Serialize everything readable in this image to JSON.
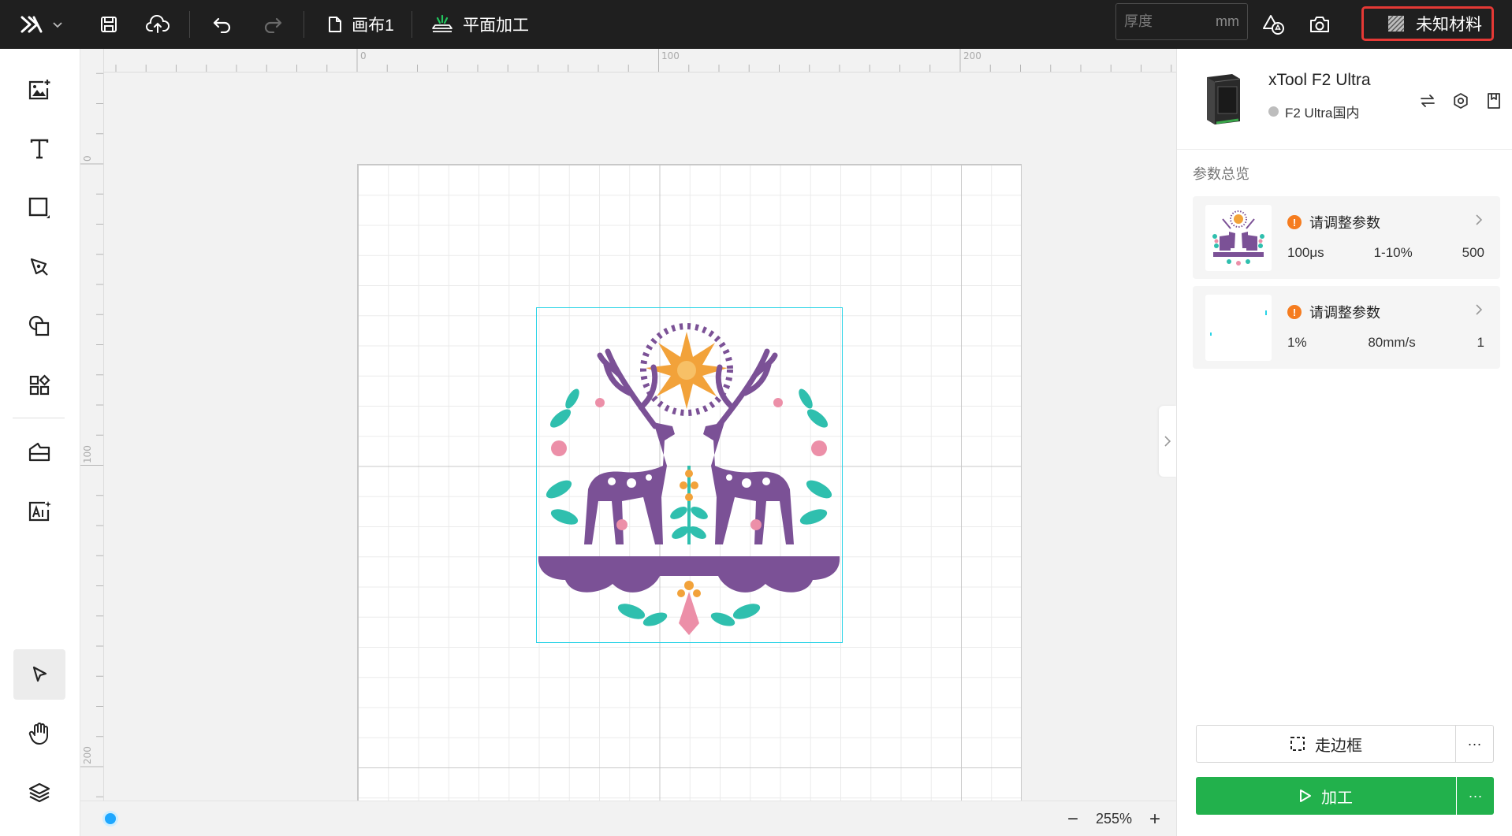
{
  "topbar": {
    "logo_icon": "xtool-x-logo",
    "canvas_name": "画布1",
    "mode_label": "平面加工",
    "thickness": {
      "placeholder": "厚度",
      "value": "",
      "unit": "mm"
    },
    "material_label": "未知材料"
  },
  "leftbar": {
    "tools": [
      "image-add-icon",
      "text-icon",
      "rectangle-icon",
      "pen-icon",
      "shapes-icon",
      "components-icon",
      "material-library-icon",
      "ai-image-icon",
      "select-icon",
      "hand-icon",
      "layers-icon"
    ],
    "active_tool": "select-icon"
  },
  "canvas": {
    "ruler_top_labels": [
      "0",
      "100",
      "200"
    ],
    "ruler_left_labels": [
      "0",
      "100",
      "200"
    ],
    "zoom": "255%",
    "zoom_out": "−",
    "zoom_in": "+"
  },
  "device": {
    "name": "xTool F2 Ultra",
    "status": "F2 Ultra国内",
    "status_color": "#bdbdbd"
  },
  "params": {
    "title": "参数总览",
    "items": [
      {
        "warning": "请调整参数",
        "v1": "100μs",
        "v2": "1-10%",
        "v3": "500"
      },
      {
        "warning": "请调整参数",
        "v1": "1%",
        "v2": "80mm/s",
        "v3": "1"
      }
    ]
  },
  "actions": {
    "frame_label": "走边框",
    "process_label": "加工",
    "more": "···"
  },
  "colors": {
    "accent_green": "#22b14c",
    "selection_cyan": "#29d3e6",
    "warning_orange": "#f57c1f",
    "material_border": "#e53935"
  }
}
